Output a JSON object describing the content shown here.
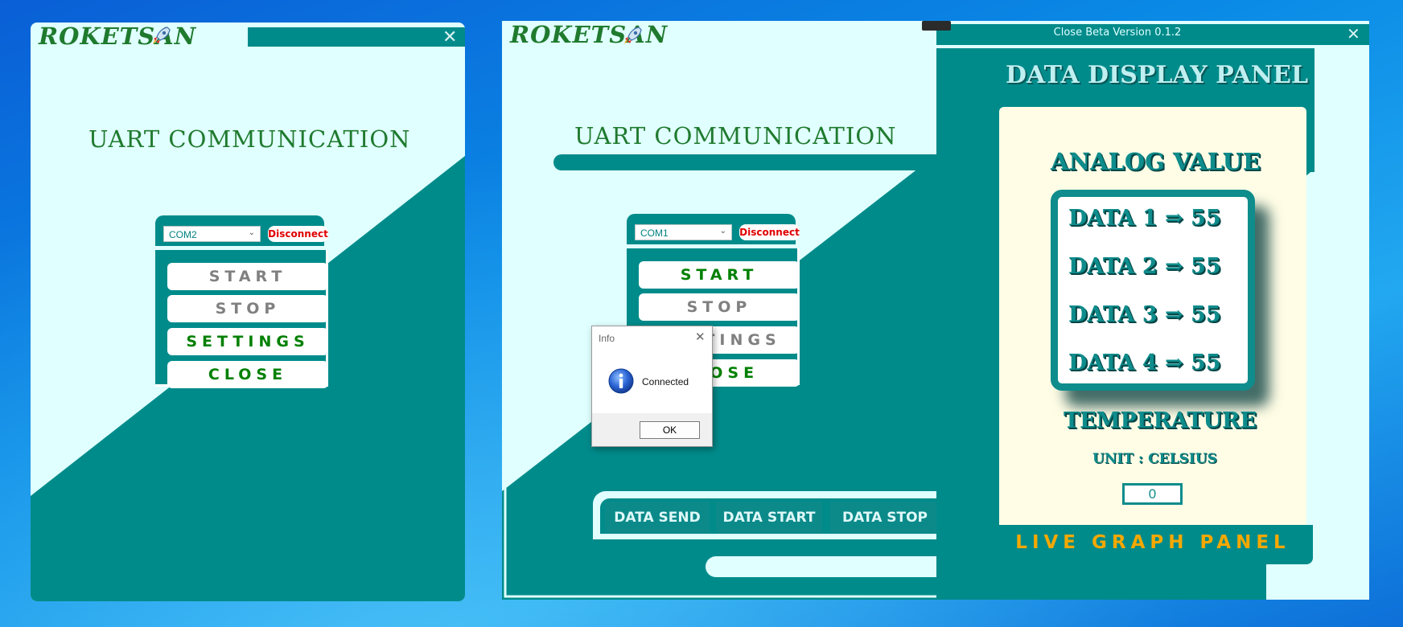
{
  "left_window": {
    "logo": "ROKETSAN",
    "title": "UART COMMUNICATION",
    "port_select": "COM2",
    "disconnect_label": "Disconnect",
    "buttons": {
      "start": "START",
      "stop": "STOP",
      "settings": "SETTINGS",
      "close": "CLOSE"
    },
    "close_glyph": "✕"
  },
  "right_window": {
    "logo": "ROKETSAN",
    "version": "Close Beta Version 0.1.2",
    "title": "UART COMMUNICATION",
    "port_select": "COM1",
    "disconnect_label": "Disconnect",
    "buttons": {
      "start": "START",
      "stop": "STOP",
      "settings": "SETTINGS",
      "close": "CLOSE"
    },
    "close_glyph": "✕",
    "toolbar": {
      "data_send": "DATA SEND",
      "data_start": "DATA START",
      "data_stop": "DATA STOP"
    },
    "data_panel": {
      "title": "DATA DISPLAY PANEL",
      "analog_title": "ANALOG VALUE",
      "data_lines": [
        "DATA 1 ⇒ 55",
        "DATA 2 ⇒ 55",
        "DATA 3 ⇒ 55",
        "DATA 4 ⇒ 55"
      ],
      "temperature_title": "TEMPERATURE",
      "unit_label": "UNIT : CELSIUS",
      "temperature_value": "0",
      "live_graph_label": "LIVE GRAPH PANEL"
    }
  },
  "dialog": {
    "title": "Info",
    "message": "Connected",
    "ok_label": "OK",
    "close_glyph": "✕"
  },
  "colors": {
    "teal": "#008b8b",
    "light_cyan": "#e0ffff",
    "cream": "#fffde6",
    "gold": "#f5a800",
    "logo_green": "#1f7a2e"
  }
}
